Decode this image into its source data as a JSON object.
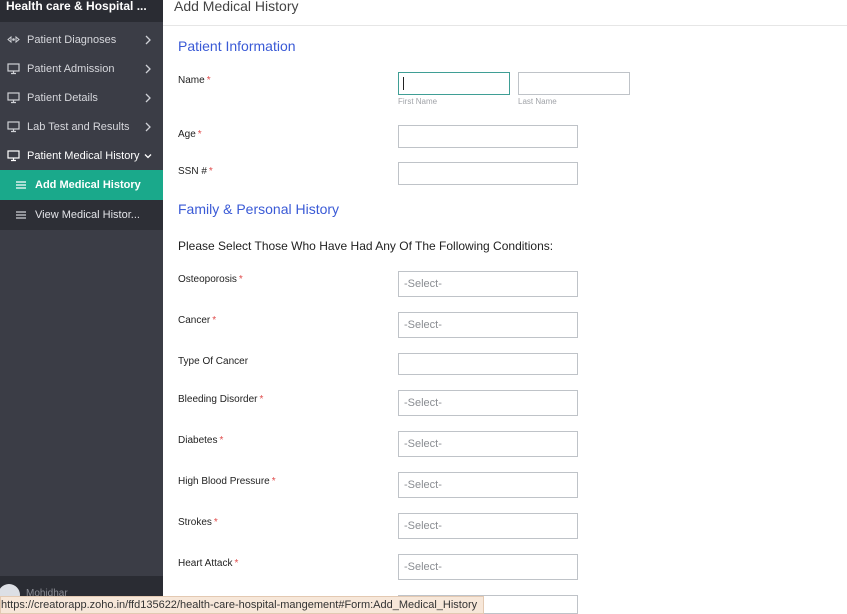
{
  "sidebar": {
    "app_title": "Health care & Hospital ...",
    "items": [
      {
        "label": "Patient Diagnoses",
        "icon": "diagnoses-icon"
      },
      {
        "label": "Patient Admission",
        "icon": "monitor-icon"
      },
      {
        "label": "Patient Details",
        "icon": "monitor-icon"
      },
      {
        "label": "Lab Test and Results",
        "icon": "monitor-icon"
      },
      {
        "label": "Patient Medical History",
        "icon": "monitor-icon"
      }
    ],
    "sub_items": [
      {
        "label": "Add Medical History",
        "icon": "list-icon"
      },
      {
        "label": "View Medical Histor...",
        "icon": "list-icon"
      }
    ],
    "user_name": "Mohidhar"
  },
  "page": {
    "title": "Add Medical History",
    "section_patient": "Patient Information",
    "section_family": "Family & Personal History",
    "prompt": "Please Select Those Who Have Had Any Of The Following Conditions:"
  },
  "form": {
    "name_label": "Name",
    "first_name_hint": "First Name",
    "last_name_hint": "Last Name",
    "age_label": "Age",
    "ssn_label": "SSN #",
    "required_mark": "*",
    "select_placeholder": "-Select-",
    "conditions": [
      {
        "label": "Osteoporosis",
        "required": true,
        "value": "-Select-"
      },
      {
        "label": "Cancer",
        "required": true,
        "value": "-Select-"
      },
      {
        "label": "Type Of Cancer",
        "required": false,
        "value": ""
      },
      {
        "label": "Bleeding Disorder",
        "required": true,
        "value": "-Select-"
      },
      {
        "label": "Diabetes",
        "required": true,
        "value": "-Select-"
      },
      {
        "label": "High Blood Pressure",
        "required": true,
        "value": "-Select-"
      },
      {
        "label": "Strokes",
        "required": true,
        "value": "-Select-"
      },
      {
        "label": "Heart Attack",
        "required": true,
        "value": "-Select-"
      }
    ]
  },
  "status_bar": {
    "url": "https://creatorapp.zoho.in/ffd135622/health-care-hospital-mangement#Form:Add_Medical_History"
  },
  "colors": {
    "sidebar_bg": "#3b3d46",
    "active_item": "#1aa98b",
    "section_heading": "#3a5ad6",
    "required": "#e04b4b"
  }
}
